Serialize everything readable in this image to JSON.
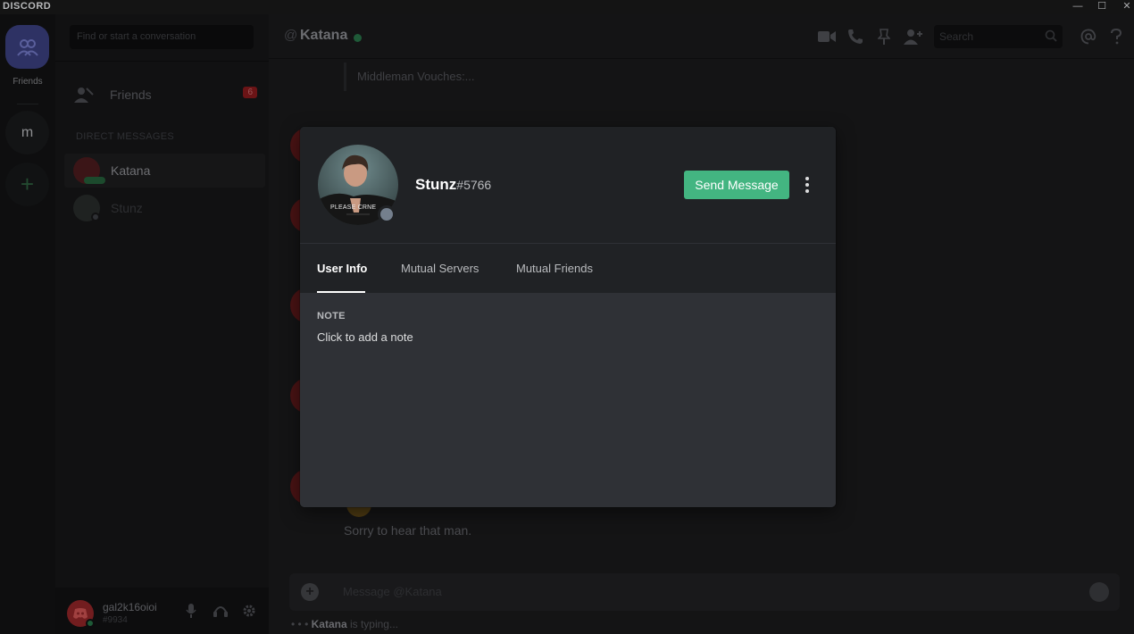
{
  "window": {
    "app_title": "DISCORD",
    "minimize": "—",
    "maximize": "☐",
    "close": "✕"
  },
  "servers": {
    "home_label": "Friends",
    "server_initial": "m",
    "add_server": "+"
  },
  "sidebar": {
    "search_placeholder": "Find or start a conversation",
    "friends_label": "Friends",
    "friends_badge": "6",
    "dm_header": "DIRECT MESSAGES",
    "dms": [
      {
        "name": "Katana",
        "status": "online",
        "active": true
      },
      {
        "name": "Stunz",
        "status": "offline",
        "active": false
      }
    ]
  },
  "user_panel": {
    "username": "gal2k16oioi",
    "tag": "#9934"
  },
  "chat": {
    "channel_name": "Katana",
    "search_placeholder": "Search",
    "embed_text": "Middleman Vouches:...",
    "last_message": "Sorry to hear that man.",
    "composer_placeholder": "Message @Katana",
    "typing_user": "Katana",
    "typing_suffix": " is typing..."
  },
  "profile_modal": {
    "username": "Stunz",
    "discriminator": "#5766",
    "avatar_caption": "PLEASE CRNE",
    "send_message_label": "Send Message",
    "tabs": [
      {
        "label": "User Info",
        "active": true
      },
      {
        "label": "Mutual Servers",
        "active": false
      },
      {
        "label": "Mutual Friends",
        "active": false
      }
    ],
    "note_label": "NOTE",
    "note_placeholder": "Click to add a note"
  },
  "colors": {
    "accent_green": "#43b581",
    "modal_bg": "#2f3136",
    "modal_header_bg": "#202225",
    "offline_status": "#747f8d",
    "danger_badge": "#6b1416"
  }
}
